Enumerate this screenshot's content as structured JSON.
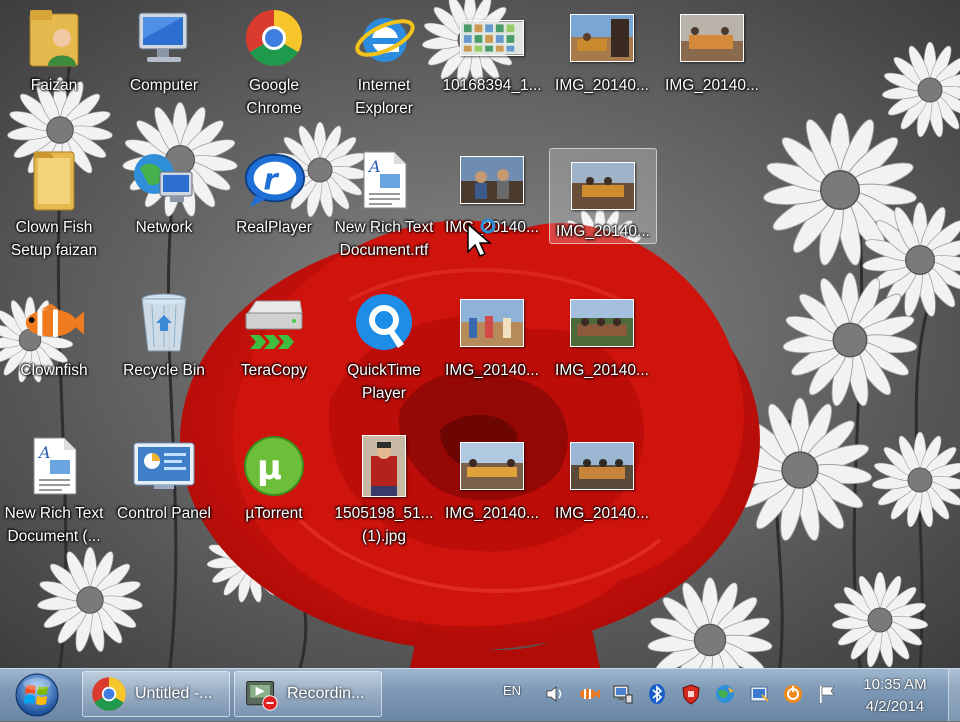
{
  "desktop": {
    "icons": [
      {
        "label": "Faizan"
      },
      {
        "label": "Computer"
      },
      {
        "label": "Google\nChrome"
      },
      {
        "label": "Internet\nExplorer"
      },
      {
        "label": "10168394_1..."
      },
      {
        "label": "IMG_20140..."
      },
      {
        "label": "IMG_20140..."
      },
      {
        "label": "Clown Fish\nSetup faizan"
      },
      {
        "label": "Network"
      },
      {
        "label": "RealPlayer"
      },
      {
        "label": "New Rich Text\nDocument.rtf"
      },
      {
        "label": "IMG_20140..."
      },
      {
        "label": "IMG_20140..."
      },
      {
        "label": "Clownfish"
      },
      {
        "label": "Recycle Bin"
      },
      {
        "label": "TeraCopy"
      },
      {
        "label": "QuickTime\nPlayer"
      },
      {
        "label": "IMG_20140..."
      },
      {
        "label": "IMG_20140..."
      },
      {
        "label": "New Rich Text\nDocument (..."
      },
      {
        "label": "Control Panel"
      },
      {
        "label": "µTorrent"
      },
      {
        "label": "1505198_51...\n(1).jpg"
      },
      {
        "label": "IMG_20140..."
      },
      {
        "label": "IMG_20140..."
      }
    ]
  },
  "taskbar": {
    "buttons": [
      {
        "label": "Untitled -...",
        "icon": "chrome-icon"
      },
      {
        "label": "Recordin...",
        "icon": "recorder-icon"
      }
    ],
    "language": "EN",
    "tray_icons": [
      "volume-icon",
      "clownfish-tray-icon",
      "network-tray-icon",
      "bluetooth-icon",
      "shield-icon",
      "globe-tray-icon",
      "update-icon",
      "orange-tray-icon",
      "action-center-flag-icon"
    ],
    "clock": {
      "time": "10:35 AM",
      "date": "4/2/2014"
    }
  },
  "colors": {
    "rose": "#d8150f",
    "taskbar": "#7f9ab6",
    "selection": "#ffffff"
  }
}
